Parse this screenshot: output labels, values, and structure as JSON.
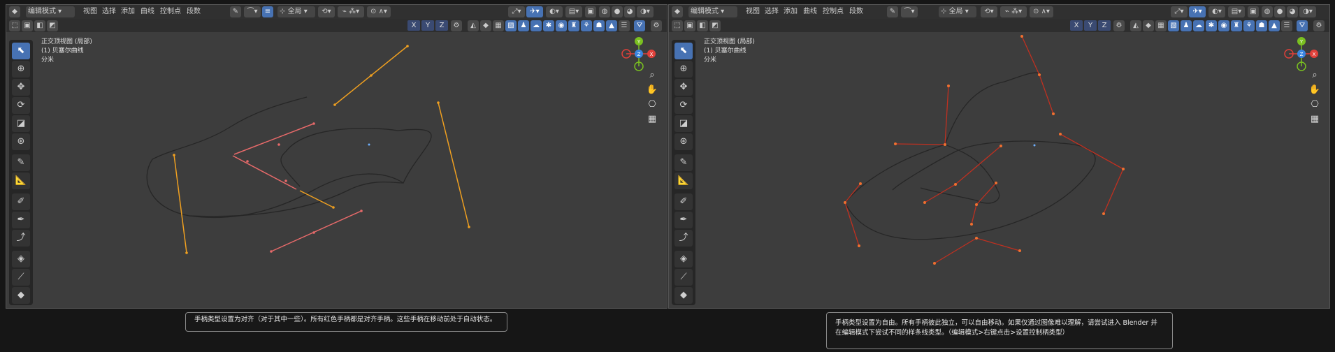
{
  "left": {
    "mode_label": "编辑模式",
    "menus": [
      "视图",
      "选择",
      "添加",
      "曲线",
      "控制点",
      "段数"
    ],
    "view_name": "正交顶视图 (局部)",
    "object_name": "(1) 贝塞尔曲线",
    "unit_label": "分米",
    "pivot_label": "全局",
    "axes": [
      "X",
      "Y",
      "Z"
    ],
    "caption": "手柄类型设置为对齐（对于其中一些）。所有红色手柄都是对齐手柄。这些手柄在移动前处于自动状态。"
  },
  "right": {
    "mode_label": "编辑模式",
    "menus": [
      "视图",
      "选择",
      "添加",
      "曲线",
      "控制点",
      "段数"
    ],
    "view_name": "正交顶视图 (局部)",
    "object_name": "(1) 贝塞尔曲线",
    "unit_label": "分米",
    "pivot_label": "全局",
    "axes": [
      "X",
      "Y",
      "Z"
    ],
    "caption": "手柄类型设置为自由。所有手柄彼此独立，可以自由移动。如果仅通过图像难以理解，请尝试进入 Blender 并在编辑模式下尝试不同的样条线类型。（编辑模式>右键点击>设置控制柄类型）"
  },
  "gizmo": {
    "x": "X",
    "y": "Y",
    "z": "Z"
  },
  "colors": {
    "auto_handle": "#f0a020",
    "aligned_handle": "#e86a6a",
    "free_handle": "#c03020",
    "curve": "#262626",
    "x_axis": "#e0403a",
    "y_axis": "#7ac020",
    "z_axis": "#3a86e0",
    "active_tool": "#4772b3"
  }
}
